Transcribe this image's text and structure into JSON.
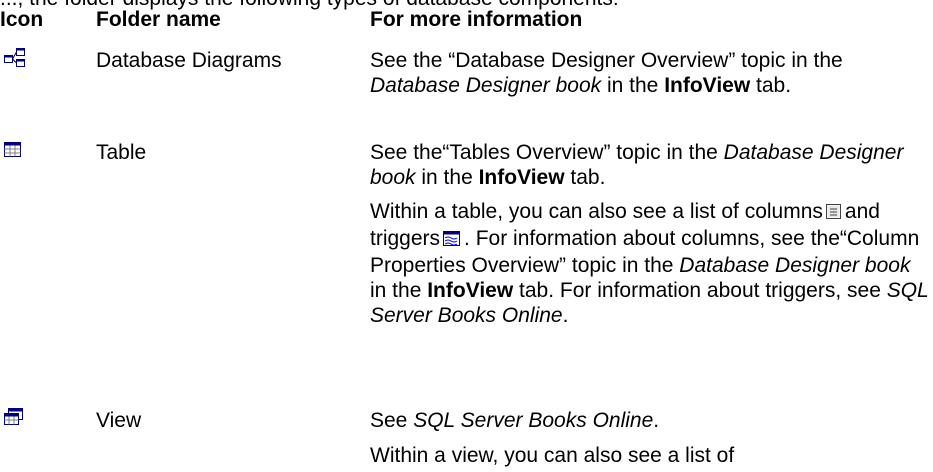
{
  "cut_line": "..., the folder displays the following types of database components:",
  "table": {
    "headers": {
      "icon": "Icon",
      "folder": "Folder name",
      "info": "For more information"
    },
    "rows": [
      {
        "icon": "database-diagram-icon",
        "folder": "Database Diagrams",
        "info": [
          {
            "t1": "See the “Database Designer Overview” topic in the ",
            "i1": "Database Designer book",
            "t2": " in the ",
            "b1": "InfoView",
            "t3": " tab."
          }
        ]
      },
      {
        "icon": "table-icon",
        "folder": "Table",
        "info": [
          {
            "t1": "See the“Tables Overview” topic in the ",
            "i1": "Database Designer book",
            "t2": " in the ",
            "b1": "InfoView",
            "t3": " tab."
          },
          {
            "t1": "Within a table, you can also see a list of columns",
            "t2": "and triggers",
            "t3": ". For information about columns, see the“Column Properties Overview” topic in the ",
            "i1": "Database Designer book",
            "t4": " in the ",
            "b1": "InfoView",
            "t5": " tab. For information about triggers, see ",
            "i2": "SQL Server Books Online",
            "t6": "."
          }
        ]
      },
      {
        "icon": "view-icon",
        "folder": "View",
        "info": [
          {
            "t1": "See ",
            "i1": "SQL Server Books Online",
            "t2": "."
          },
          {
            "t1": "Within a view, you can also see a list of"
          }
        ]
      }
    ]
  },
  "inline_icons": {
    "columns": "column-icon",
    "triggers": "trigger-icon"
  }
}
